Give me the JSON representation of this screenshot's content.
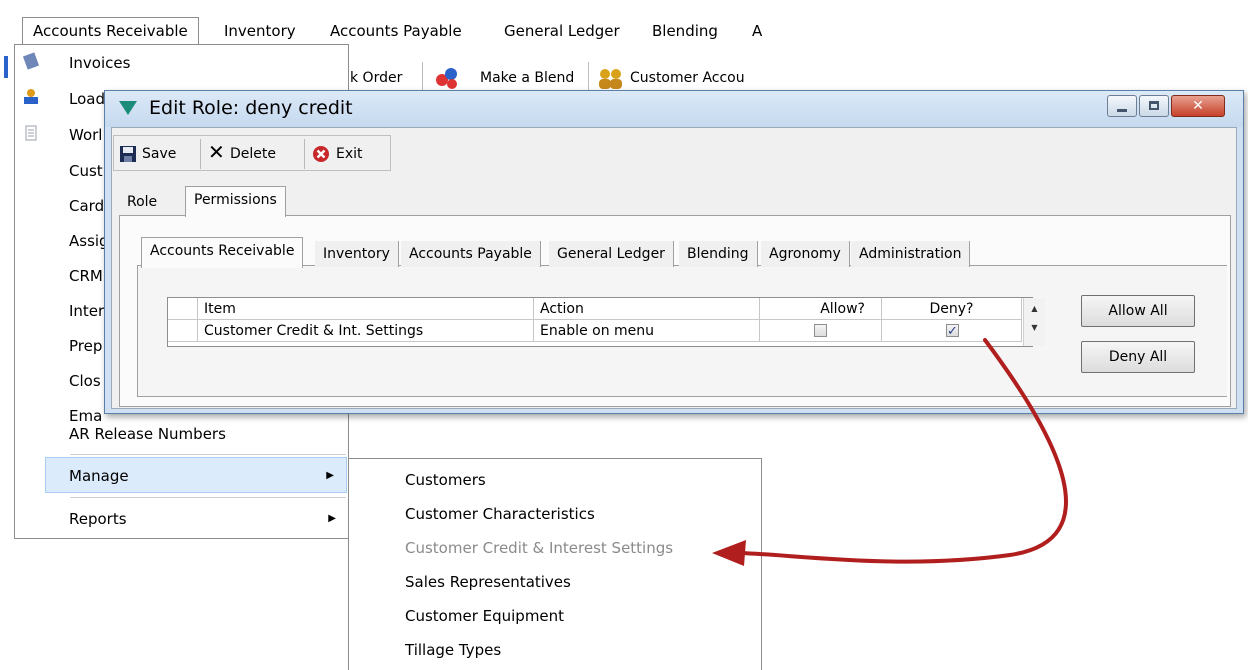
{
  "menubar": {
    "items": [
      "Accounts Receivable",
      "Inventory",
      "Accounts Payable",
      "General Ledger",
      "Blending",
      "A"
    ]
  },
  "background_toolbar": {
    "items": [
      "k Order",
      "Make a Blend",
      "Customer Accou"
    ]
  },
  "ar_menu": {
    "items": [
      "Invoices",
      "Load",
      "Worl",
      "Cust",
      "Card",
      "Assig",
      "CRM",
      "Inter",
      "Prep",
      "Clos",
      "Ema",
      "AR Release Numbers"
    ],
    "manage": "Manage",
    "reports": "Reports"
  },
  "submenu": {
    "items": [
      "Customers",
      "Customer Characteristics",
      "Customer Credit & Interest Settings",
      "Sales Representatives",
      "Customer Equipment",
      "Tillage Types"
    ]
  },
  "dialog": {
    "title": "Edit Role: deny credit",
    "toolbar": {
      "save": "Save",
      "delete": "Delete",
      "exit": "Exit"
    },
    "tabs": [
      "Role",
      "Permissions"
    ],
    "subtabs": [
      "Accounts Receivable",
      "Inventory",
      "Accounts Payable",
      "General Ledger",
      "Blending",
      "Agronomy",
      "Administration"
    ],
    "grid": {
      "headers": {
        "item": "Item",
        "action": "Action",
        "allow": "Allow?",
        "deny": "Deny?"
      },
      "rows": [
        {
          "item": "Customer Credit & Int. Settings",
          "action": "Enable on menu",
          "allow": false,
          "deny": true
        }
      ]
    },
    "allow_all": "Allow All",
    "deny_all": "Deny All"
  },
  "colors": {
    "arrow": "#b01e1e",
    "highlight": "#dcebfc"
  }
}
